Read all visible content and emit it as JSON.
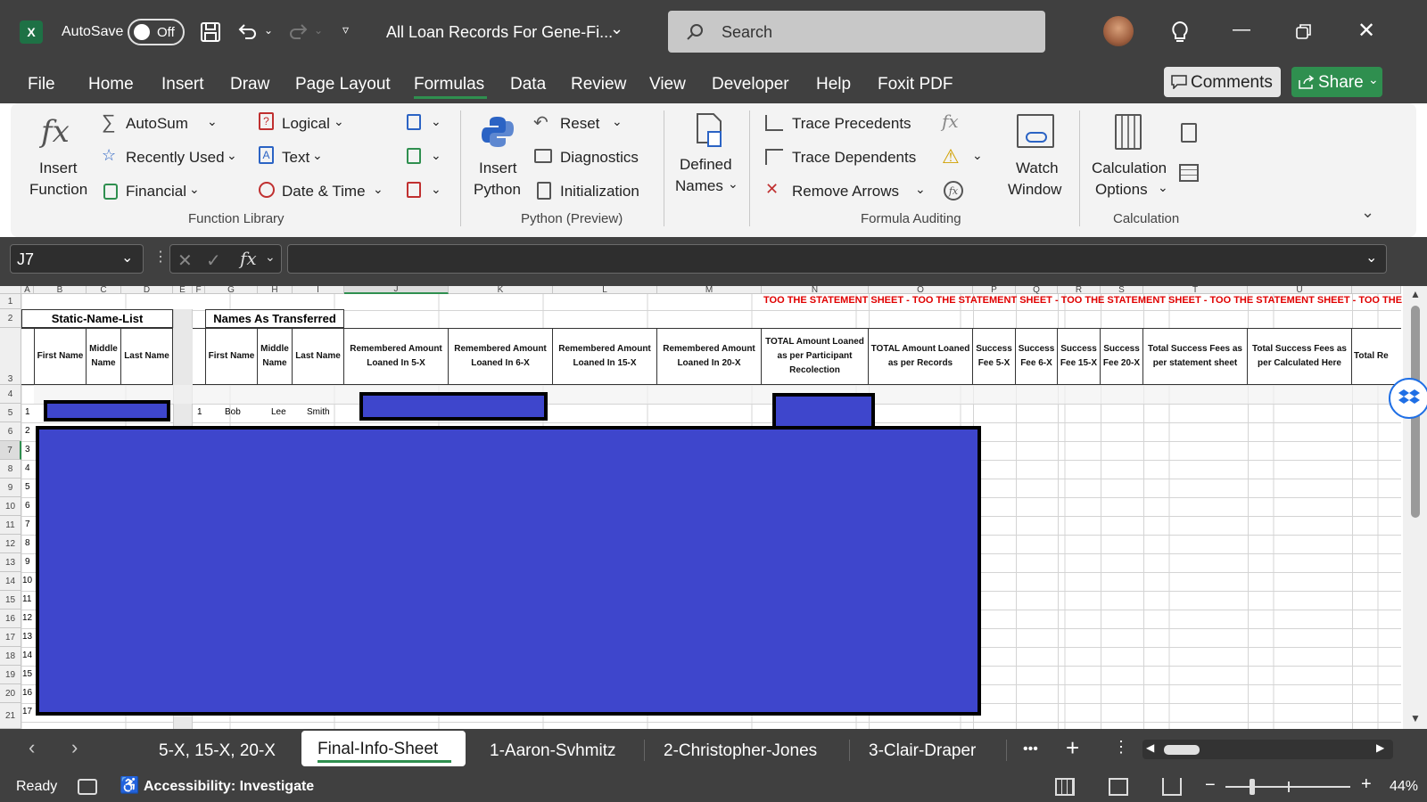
{
  "window": {
    "autosave_label": "AutoSave",
    "autosave_state": "Off",
    "doc_title": "All Loan Records For Gene-Fi...",
    "search_placeholder": "Search",
    "accent": "#2f8f4f"
  },
  "menu": {
    "items": [
      "File",
      "Home",
      "Insert",
      "Draw",
      "Page Layout",
      "Formulas",
      "Data",
      "Review",
      "View",
      "Developer",
      "Help",
      "Foxit PDF"
    ],
    "active": "Formulas",
    "comments": "Comments",
    "share": "Share"
  },
  "ribbon": {
    "insert_function": [
      "Insert",
      "Function"
    ],
    "autosum": "AutoSum",
    "recently_used": "Recently Used",
    "financial": "Financial",
    "logical": "Logical",
    "text": "Text",
    "date_time": "Date & Time",
    "function_library": "Function Library",
    "insert_python": [
      "Insert",
      "Python"
    ],
    "reset": "Reset",
    "diagnostics": "Diagnostics",
    "initialization": "Initialization",
    "python_preview": "Python (Preview)",
    "defined_names": [
      "Defined",
      "Names"
    ],
    "trace_precedents": "Trace Precedents",
    "trace_dependents": "Trace Dependents",
    "remove_arrows": "Remove Arrows",
    "formula_auditing": "Formula Auditing",
    "watch_window": [
      "Watch",
      "Window"
    ],
    "calculation_options": [
      "Calculation",
      "Options"
    ],
    "calculation": "Calculation"
  },
  "formula_bar": {
    "name_box": "J7",
    "value": ""
  },
  "sheet": {
    "columns": [
      "A",
      "B",
      "C",
      "D",
      "E",
      "F",
      "G",
      "H",
      "I",
      "J",
      "K",
      "L",
      "M",
      "N",
      "O",
      "P",
      "Q",
      "R",
      "S",
      "T",
      "U"
    ],
    "rows": [
      "1",
      "2",
      "3",
      "4",
      "5",
      "6",
      "7",
      "8",
      "9",
      "10",
      "11",
      "12",
      "13",
      "14",
      "15",
      "16",
      "17",
      "18",
      "19",
      "20",
      "21"
    ],
    "banner": "TOO THE STATEMENT SHEET  -  TOO THE STATEMENT SHEET  -  TOO THE STATEMENT SHEET  -  TOO THE STATEMENT SHEET  -  TOO THE STATEMENT SHEET",
    "static_name_list": "Static-Name-List",
    "names_as_transferred": "Names As Transferred",
    "headers": {
      "B": "First Name",
      "C": "Middle Name",
      "D": "Last Name",
      "G": "First Name",
      "H": "Middle Name",
      "I": "Last Name",
      "J": "Remembered Amount Loaned In 5-X",
      "K": "Remembered Amount Loaned In 6-X",
      "L": "Remembered Amount Loaned In 15-X",
      "M": "Remembered Amount Loaned In 20-X",
      "N": "TOTAL Amount Loaned as per Participant Recolection",
      "O": "TOTAL Amount Loaned as per Records",
      "P": "Success Fee 5-X",
      "Q": "Success Fee 6-X",
      "R": "Success Fee 15-X",
      "S": "Success Fee 20-X",
      "T": "Total Success Fees as per statement sheet",
      "U": "Total Success Fees as per Calculated Here",
      "V": "Total Re"
    },
    "row_nums": [
      "1",
      "2",
      "3",
      "4",
      "5",
      "6",
      "7",
      "8",
      "9",
      "10",
      "11",
      "12",
      "13",
      "14",
      "15",
      "16",
      "17"
    ],
    "row5": {
      "num": "1",
      "first": "Bob",
      "middle": "Lee",
      "last": "Smith"
    }
  },
  "sheet_tabs": {
    "tabs": [
      "5-X, 15-X, 20-X",
      "Final-Info-Sheet",
      "1-Aaron-Svhmitz",
      "2-Christopher-Jones",
      "3-Clair-Draper"
    ],
    "active": "Final-Info-Sheet",
    "more": "•••"
  },
  "status": {
    "ready": "Ready",
    "accessibility": "Accessibility: Investigate",
    "zoom": "44%"
  }
}
